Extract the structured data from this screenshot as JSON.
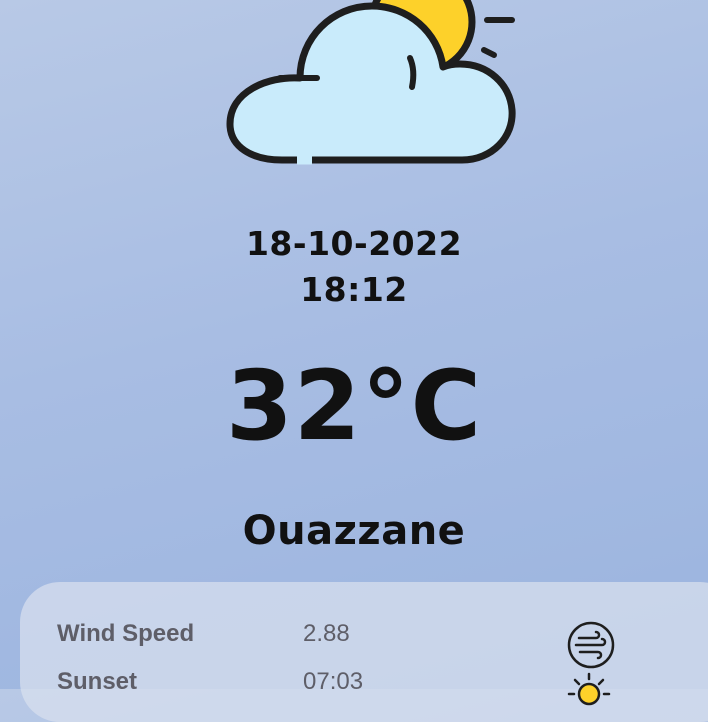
{
  "weather": {
    "condition_icon": "partly-cloudy-icon",
    "date": "18-10-2022",
    "time": "18:12",
    "temperature": "32°C",
    "city": "Ouazzane"
  },
  "details": {
    "wind_speed": {
      "label": "Wind Speed",
      "value": "2.88",
      "icon": "wind-icon"
    },
    "sunset": {
      "label": "Sunset",
      "value": "07:03",
      "icon": "sun-icon"
    }
  },
  "colors": {
    "background": "#a8bde3",
    "cloud_fill": "#c9ebfb",
    "sun_fill": "#fdd12a",
    "outline": "#1e1e1e",
    "card": "#d7dfee",
    "detail_text": "#5e5e68"
  }
}
